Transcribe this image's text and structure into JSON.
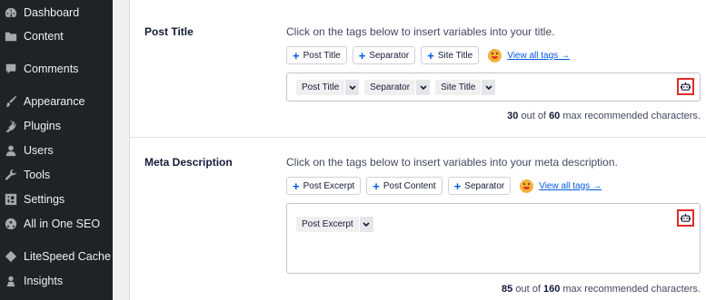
{
  "sidebar": {
    "items": [
      {
        "label": "Dashboard",
        "icon": "dashboard-icon"
      },
      {
        "label": "Content",
        "icon": "folder-icon"
      },
      {
        "label": "Comments",
        "icon": "comment-icon"
      },
      {
        "label": "Appearance",
        "icon": "brush-icon"
      },
      {
        "label": "Plugins",
        "icon": "plugin-icon"
      },
      {
        "label": "Users",
        "icon": "user-icon"
      },
      {
        "label": "Tools",
        "icon": "wrench-icon"
      },
      {
        "label": "Settings",
        "icon": "settings-icon"
      },
      {
        "label": "All in One SEO",
        "icon": "seo-icon"
      },
      {
        "label": "LiteSpeed Cache",
        "icon": "diamond-icon"
      },
      {
        "label": "Insights",
        "icon": "insights-icon"
      }
    ]
  },
  "post_title": {
    "label": "Post Title",
    "instructions": "Click on the tags below to insert variables into your title.",
    "tags": [
      "Post Title",
      "Separator",
      "Site Title"
    ],
    "view_all": "View all tags →",
    "chips": [
      "Post Title",
      "Separator",
      "Site Title"
    ],
    "count": "30",
    "max": "60",
    "out_of": "out of",
    "suffix": "max recommended characters."
  },
  "meta_description": {
    "label": "Meta Description",
    "instructions": "Click on the tags below to insert variables into your meta description.",
    "tags": [
      "Post Excerpt",
      "Post Content",
      "Separator"
    ],
    "view_all": "View all tags →",
    "chips": [
      "Post Excerpt"
    ],
    "count": "85",
    "max": "160",
    "out_of": "out of",
    "suffix": "max recommended characters."
  },
  "colors": {
    "sidebar_bg": "#1d2327",
    "accent_blue": "#005ae0",
    "highlight_red": "#e02b27"
  }
}
